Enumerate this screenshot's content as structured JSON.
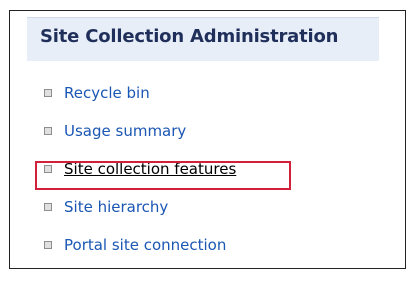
{
  "panel": {
    "title": "Site Collection Administration",
    "items": [
      {
        "label": "Recycle bin"
      },
      {
        "label": "Usage summary"
      },
      {
        "label": "Site collection features"
      },
      {
        "label": "Site hierarchy"
      },
      {
        "label": "Portal site connection"
      }
    ]
  },
  "colors": {
    "link": "#1a56b4",
    "header_bg": "#e8eef8",
    "title_text": "#1f2f5a",
    "highlight_border": "#d3203a"
  }
}
